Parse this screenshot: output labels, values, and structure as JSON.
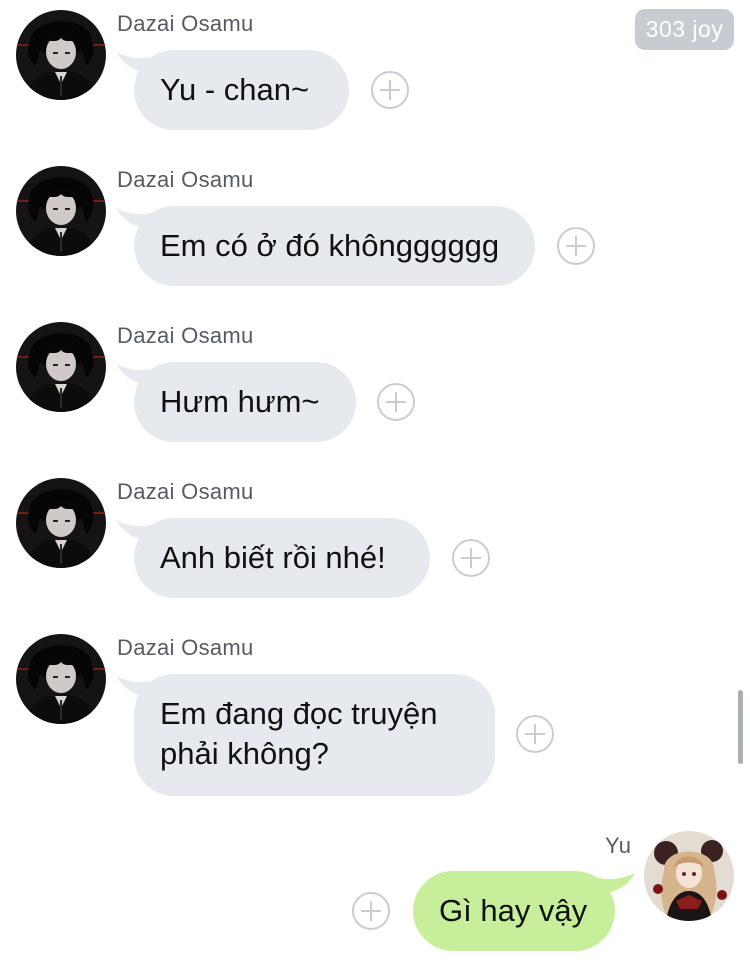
{
  "badge": {
    "text": "303 joy"
  },
  "messages": [
    {
      "sender": "Dazai Osamu",
      "text": "Yu - chan~"
    },
    {
      "sender": "Dazai Osamu",
      "text": "Em có ở đó khôngggggg"
    },
    {
      "sender": "Dazai Osamu",
      "text": "Hưm hưm~"
    },
    {
      "sender": "Dazai Osamu",
      "text": "Anh biết rồi nhé!"
    },
    {
      "sender": "Dazai Osamu",
      "text_line1": "Em đang đọc truyện",
      "text_line2": "phải không?"
    },
    {
      "sender": "Yu",
      "text": "Gì hay vậy"
    }
  ],
  "icons": {
    "add_reaction": "plus-circle-icon",
    "avatar_other": "dazai-avatar",
    "avatar_self": "yu-avatar"
  },
  "colors": {
    "incoming_bubble": "#e6e9ee",
    "outgoing_bubble": "#c7ef9b",
    "badge": "#c7ccd3"
  }
}
